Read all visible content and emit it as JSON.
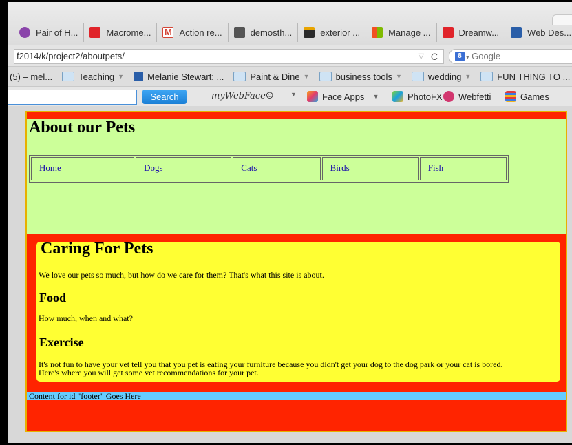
{
  "tabs": [
    {
      "label": "Pair of H...",
      "color": "#8a44aa"
    },
    {
      "label": "Macrome...",
      "color": "#e0242a"
    },
    {
      "label": "Action re...",
      "color": "#d44638"
    },
    {
      "label": "demosth...",
      "color": "#555555"
    },
    {
      "label": "exterior ...",
      "color": "#2b2b2b"
    },
    {
      "label": "Manage ...",
      "color": "#f25022"
    },
    {
      "label": "Dreamw...",
      "color": "#e0242a"
    },
    {
      "label": "Web Des...",
      "color": "#2a5ea8"
    }
  ],
  "url": "f2014/k/project2/aboutpets/",
  "search_engine": "Google",
  "bookmarks": [
    {
      "label": "(5) – mel...",
      "type": "text"
    },
    {
      "label": "Teaching",
      "type": "folder",
      "caret": true
    },
    {
      "label": "Melanie Stewart: ...",
      "type": "grid",
      "caret": false
    },
    {
      "label": "Paint & Dine",
      "type": "folder",
      "caret": true
    },
    {
      "label": "business tools",
      "type": "folder",
      "caret": true
    },
    {
      "label": "wedding",
      "type": "folder",
      "caret": true
    },
    {
      "label": "FUN THING TO ...",
      "type": "folder",
      "caret": true
    }
  ],
  "toolbar": {
    "search_button": "Search",
    "brand": "myWebFace☺",
    "face_apps": "Face Apps",
    "photofx": "PhotoFX",
    "webfetti": "Webfetti",
    "games": "Games"
  },
  "page": {
    "header_title": "About our Pets",
    "nav": [
      "Home",
      "Dogs",
      "Cats",
      "Birds",
      "Fish"
    ],
    "main_title": "Caring For Pets",
    "intro": "We love our pets so much, but how do we care for them? That's what this site is about.",
    "food_heading": "Food",
    "food_text": "How much, when and what?",
    "exercise_heading": "Exercise",
    "exercise_text_1": "It's not fun to have your vet tell you that you pet is eating your furniture because you didn't get your dog to the dog park or your cat is bored.",
    "exercise_text_2": "Here's where you will get some vet recommendations for your pet.",
    "footer": "Content for id \"footer\" Goes Here"
  },
  "colors": {
    "container_bg": "#ff2400",
    "header_bg": "#ccff99",
    "content_bg": "#ffff33",
    "footer_bg": "#66ccff",
    "border": "#e8b000"
  }
}
